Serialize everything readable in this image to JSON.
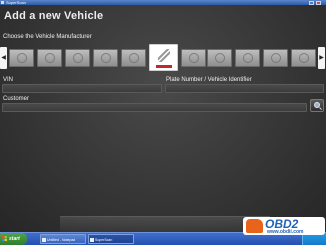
{
  "window": {
    "title": "SuperScan"
  },
  "page": {
    "title": "Add a new Vehicle"
  },
  "manufacturer": {
    "section_label": "Choose the Vehicle Manufacturer",
    "prev_symbol": "◀",
    "next_symbol": "▶",
    "logos": [
      {
        "icon": "manufacturer-logo-icon",
        "selected": false
      },
      {
        "icon": "manufacturer-logo-icon",
        "selected": false
      },
      {
        "icon": "manufacturer-logo-icon",
        "selected": false
      },
      {
        "icon": "manufacturer-logo-icon",
        "selected": false
      },
      {
        "icon": "citroen-logo-icon",
        "selected": true
      },
      {
        "icon": "manufacturer-logo-icon",
        "selected": false
      },
      {
        "icon": "manufacturer-logo-icon",
        "selected": false
      },
      {
        "icon": "manufacturer-logo-icon",
        "selected": false
      },
      {
        "icon": "manufacturer-logo-icon",
        "selected": false
      },
      {
        "icon": "manufacturer-logo-icon",
        "selected": false
      }
    ]
  },
  "form": {
    "vin_label": "VIN",
    "vin_value": "",
    "plate_label": "Plate Number / Vehicle Identifier",
    "plate_value": "",
    "customer_label": "Customer",
    "customer_value": ""
  },
  "taskbar": {
    "start_label": "start",
    "items": [
      {
        "label": "Untitled - Notepad",
        "active": false
      },
      {
        "label": "SuperScan",
        "active": true
      }
    ]
  },
  "watermark": {
    "brand": "OBD2",
    "url": "www.obdii.com"
  },
  "colors": {
    "background": "#3a3a3a",
    "taskbar": "#2550b0",
    "selected_logo_accent": "#c0282d",
    "watermark_brand": "#1f63b5",
    "watermark_car": "#e8641b"
  }
}
